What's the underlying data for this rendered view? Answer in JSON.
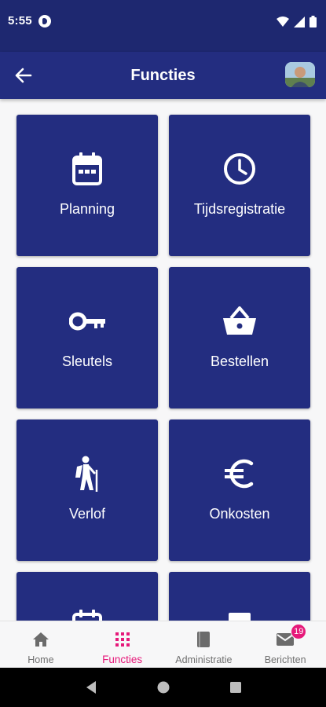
{
  "status_bar": {
    "time": "5:55",
    "icons": [
      "notification-icon",
      "wifi-icon",
      "signal-icon",
      "battery-icon"
    ]
  },
  "app_bar": {
    "title": "Functies",
    "back_icon": "arrow-left-icon",
    "avatar": "user-avatar"
  },
  "tiles": [
    {
      "label": "Planning",
      "icon": "calendar-icon"
    },
    {
      "label": "Tijdsregistratie",
      "icon": "clock-icon"
    },
    {
      "label": "Sleutels",
      "icon": "key-icon"
    },
    {
      "label": "Bestellen",
      "icon": "basket-icon"
    },
    {
      "label": "Verlof",
      "icon": "hiker-icon"
    },
    {
      "label": "Onkosten",
      "icon": "euro-icon"
    }
  ],
  "bottom_nav": {
    "items": [
      {
        "label": "Home",
        "icon": "home-icon"
      },
      {
        "label": "Functies",
        "icon": "grid-icon",
        "active": true
      },
      {
        "label": "Administratie",
        "icon": "book-icon"
      },
      {
        "label": "Berichten",
        "icon": "mail-icon",
        "badge": "19"
      }
    ]
  },
  "colors": {
    "primary": "#232d80",
    "status_bar": "#1e2870",
    "accent": "#e6197a"
  }
}
